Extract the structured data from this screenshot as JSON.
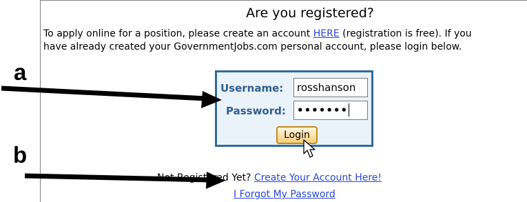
{
  "heading": "Are you registered?",
  "intro": {
    "line1_before": "To apply online for a position, please create an account ",
    "here_link": "HERE",
    "line1_after": " (registration is free). If you",
    "line2": "have already created your GovernmentJobs.com personal account, please login below."
  },
  "login": {
    "username_label": "Username:",
    "username_value": "rosshanson",
    "password_label": "Password:",
    "password_mask": "•••••••",
    "login_button": "Login"
  },
  "register": {
    "prompt": "Not Registered Yet? ",
    "create_link": "Create Your Account Here!",
    "forgot_link": "I Forgot My Password"
  },
  "callouts": {
    "a": "a",
    "b": "b"
  },
  "colors": {
    "login_box_border": "#2f6b9b",
    "login_box_bg": "#eaf2fa",
    "label_text": "#2f5f8f",
    "link": "#2b47d6",
    "button_border": "#c08a20"
  },
  "icons": {
    "cursor": "mouse-pointer-icon",
    "arrow_a": "arrow-right-icon",
    "arrow_b": "arrow-right-icon"
  }
}
